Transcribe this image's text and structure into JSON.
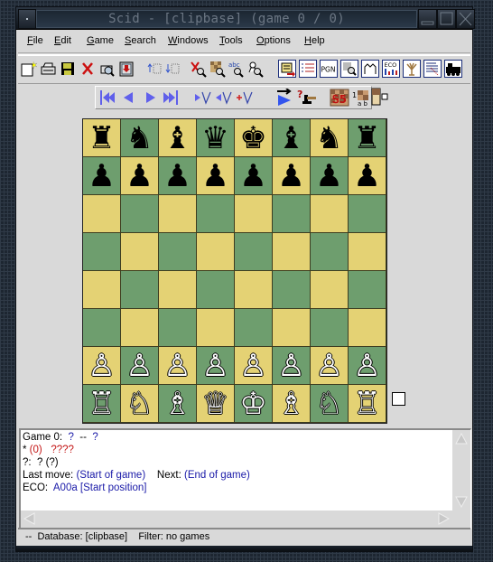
{
  "window": {
    "title": "Scid - [clipbase] (game 0 / 0)",
    "controls": [
      "window-menu",
      "minimize",
      "maximize",
      "close"
    ]
  },
  "menubar": {
    "items": [
      {
        "label": "File",
        "mnemonic": "F",
        "rest": "ile"
      },
      {
        "label": "Edit",
        "mnemonic": "E",
        "rest": "dit"
      },
      {
        "label": "Game",
        "mnemonic": "G",
        "rest": "ame"
      },
      {
        "label": "Search",
        "mnemonic": "S",
        "rest": "earch"
      },
      {
        "label": "Windows",
        "mnemonic": "W",
        "rest": "indows"
      },
      {
        "label": "Tools",
        "mnemonic": "T",
        "rest": "ools"
      },
      {
        "label": "Options",
        "mnemonic": "O",
        "rest": "ptions"
      },
      {
        "label": "Help",
        "mnemonic": "H",
        "rest": "elp"
      }
    ]
  },
  "toolbar": {
    "buttons": [
      {
        "icon": "new-database-icon"
      },
      {
        "icon": "open-database-icon"
      },
      {
        "icon": "save-game-icon"
      },
      {
        "icon": "close-database-icon"
      },
      {
        "icon": "finder-icon"
      },
      {
        "icon": "bookmark-icon"
      },
      {
        "icon": "previous-game-icon"
      },
      {
        "icon": "next-game-icon"
      },
      {
        "icon": "reset-search-icon"
      },
      {
        "icon": "board-search-icon"
      },
      {
        "icon": "header-search-icon"
      },
      {
        "icon": "material-search-icon"
      },
      {
        "icon": "game-list-icon"
      },
      {
        "icon": "switcher-icon"
      },
      {
        "icon": "pgn-window-icon",
        "label": "PGN"
      },
      {
        "icon": "crosstable-icon"
      },
      {
        "icon": "tree-icon"
      },
      {
        "icon": "eco-browser-icon",
        "label": "ECO"
      },
      {
        "icon": "tree-window-icon"
      },
      {
        "icon": "crosstable-list-icon"
      },
      {
        "icon": "engine-icon"
      }
    ]
  },
  "navbar": {
    "buttons": [
      {
        "icon": "goto-start-icon"
      },
      {
        "icon": "back-icon"
      },
      {
        "icon": "forward-icon"
      },
      {
        "icon": "goto-end-icon"
      },
      {
        "icon": "enter-variation-icon"
      },
      {
        "icon": "exit-variation-icon"
      },
      {
        "icon": "add-variation-icon"
      },
      {
        "icon": "autoplay-icon"
      },
      {
        "icon": "trial-mode-icon"
      },
      {
        "icon": "flip-board-icon"
      },
      {
        "icon": "show-coords-icon",
        "label": "ab"
      },
      {
        "icon": "show-material-icon"
      }
    ]
  },
  "board": {
    "colors": {
      "light": "#e4d274",
      "dark": "#6e9e6e"
    },
    "ranks": [
      [
        "♜",
        "♞",
        "♝",
        "♛",
        "♚",
        "♝",
        "♞",
        "♜"
      ],
      [
        "♟",
        "♟",
        "♟",
        "♟",
        "♟",
        "♟",
        "♟",
        "♟"
      ],
      [
        "",
        "",
        "",
        "",
        "",
        "",
        "",
        ""
      ],
      [
        "",
        "",
        "",
        "",
        "",
        "",
        "",
        ""
      ],
      [
        "",
        "",
        "",
        "",
        "",
        "",
        "",
        ""
      ],
      [
        "",
        "",
        "",
        "",
        "",
        "",
        "",
        ""
      ],
      [
        "♙",
        "♙",
        "♙",
        "♙",
        "♙",
        "♙",
        "♙",
        "♙"
      ],
      [
        "♖",
        "♘",
        "♗",
        "♕",
        "♔",
        "♗",
        "♘",
        "♖"
      ]
    ],
    "side_to_move": "white"
  },
  "info": {
    "line1": {
      "prefix": "Game 0:  ",
      "white": "?",
      "sep": "  --  ",
      "black": "?"
    },
    "line2": {
      "result": "* ",
      "elo": "(0)",
      "date": "   ????"
    },
    "line3": "?:  ? (?)",
    "line4": {
      "last_label": "Last move: ",
      "last_value": "(Start of game)",
      "next_label": "    Next: ",
      "next_value": "(End of game)"
    },
    "line5": {
      "eco_label": "ECO:  ",
      "eco_value": "A00a [Start position]"
    }
  },
  "status": {
    "text": "--  Database: [clipbase]    Filter: no games"
  }
}
